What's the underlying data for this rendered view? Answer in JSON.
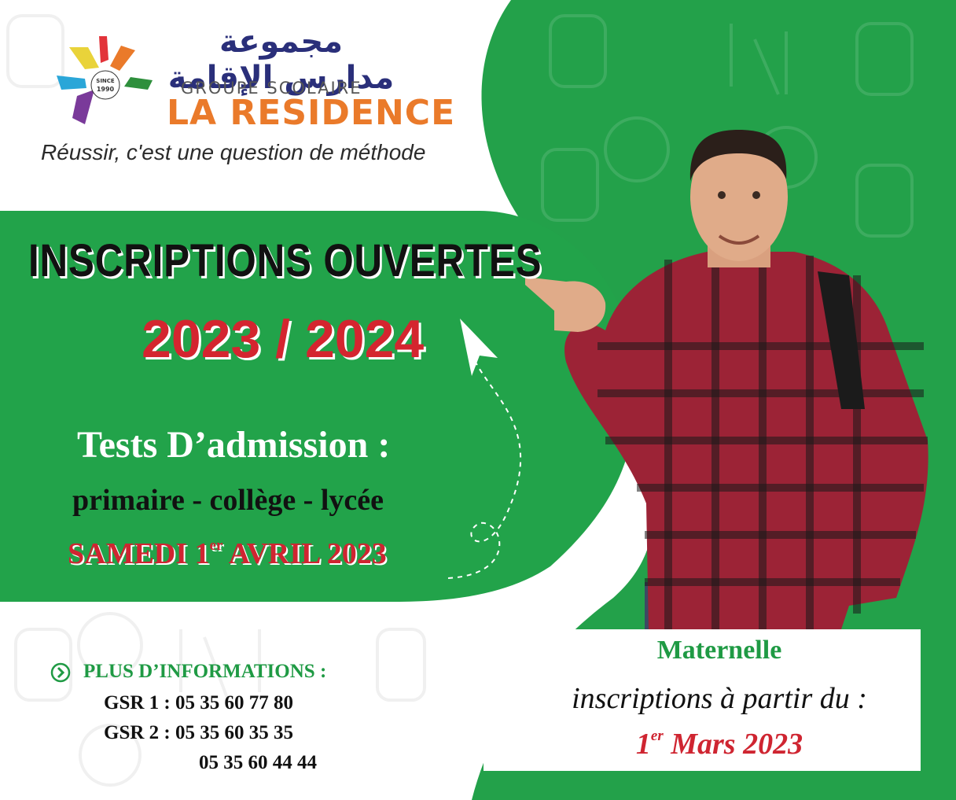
{
  "brand": {
    "arabic_name": "مجموعة مدارس الإقامة",
    "group_label": "GROUPE SCOLAIRE",
    "name": "LA RESIDENCE",
    "since_label": "SINCE",
    "since_year": "1990",
    "tagline": "Réussir, c'est une question de méthode"
  },
  "headline": {
    "title": "INSCRIPTIONS OUVERTES",
    "year": "2023 / 2024"
  },
  "admission": {
    "title": "Tests D’admission :",
    "levels": "primaire - collège - lycée",
    "date_day": "SAMEDI 1",
    "date_sup": "er",
    "date_rest": " AVRIL 2023"
  },
  "contact": {
    "title": "PLUS D’INFORMATIONS :",
    "lines": [
      "GSR 1 : 05 35 60 77 80",
      "GSR 2 : 05 35 60 35 35",
      "05 35 60 44 44"
    ]
  },
  "maternelle": {
    "title": "Maternelle",
    "subtitle": "inscriptions à partir du :",
    "date_num": "1",
    "date_sup": "er",
    "date_rest": " Mars 2023"
  },
  "colors": {
    "green": "#1f9a44",
    "red": "#cf2531",
    "orange": "#ea7a2a",
    "navy": "#2a2f7a"
  }
}
